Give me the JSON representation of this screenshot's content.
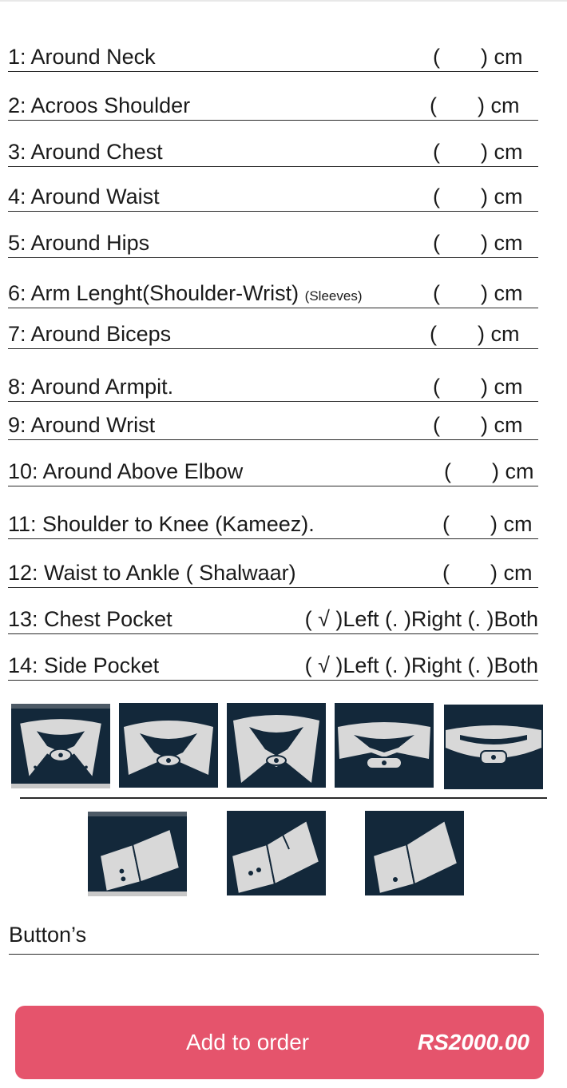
{
  "measurements": [
    {
      "label": "1: Around Neck",
      "unit": "cm"
    },
    {
      "label": "2: Acroos Shoulder",
      "unit": "cm"
    },
    {
      "label": "3: Around Chest",
      "unit": "cm"
    },
    {
      "label": "4: Around Waist",
      "unit": "cm"
    },
    {
      "label": "5: Around Hips",
      "unit": "cm"
    },
    {
      "label": "6: Arm Lenght(Shoulder-Wrist)",
      "note": "(Sleeves)",
      "unit": "cm"
    },
    {
      "label": "7: Around Biceps",
      "unit": "cm"
    },
    {
      "label": "8: Around Armpit.",
      "unit": "cm"
    },
    {
      "label": "9: Around Wrist",
      "unit": "cm"
    },
    {
      "label": "10: Around Above Elbow",
      "unit": "cm"
    },
    {
      "label": "11: Shoulder to Knee (Kameez).",
      "unit": "cm"
    },
    {
      "label": "12: Waist to Ankle ( Shalwaar)",
      "unit": "cm"
    }
  ],
  "pockets": [
    {
      "label": "13: Chest Pocket",
      "options": "( √ )Left  (.  )Right (.  )Both"
    },
    {
      "label": "14: Side Pocket",
      "options": "( √ )Left  (.  )Right (.  )Both"
    }
  ],
  "paren_open": "(",
  "paren_close": ")",
  "collar_icons": [
    "collar-style-1-icon",
    "collar-style-2-icon",
    "collar-style-3-icon",
    "collar-style-4-icon",
    "collar-style-5-icon"
  ],
  "cuff_icons": [
    "cuff-style-1-icon",
    "cuff-style-2-icon",
    "cuff-style-3-icon"
  ],
  "buttons_label": "Button’s",
  "order": {
    "label": "Add  to order",
    "price": "RS2000.00"
  },
  "colors": {
    "accent": "#e5546c",
    "thumb_bg": "#13283a",
    "shape": "#d8d8d8"
  }
}
